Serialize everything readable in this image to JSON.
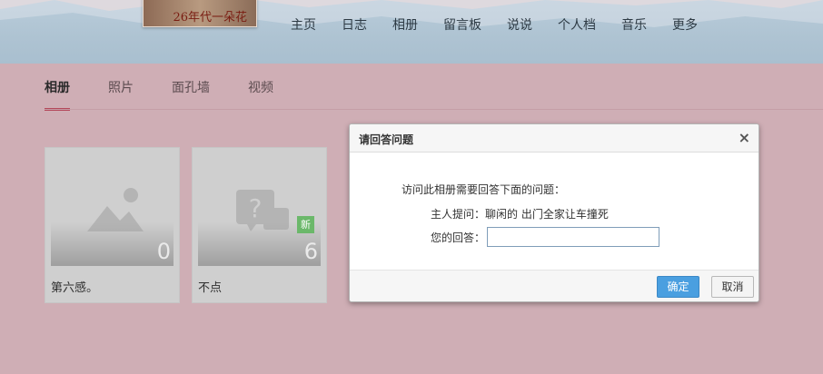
{
  "header": {
    "avatar_caption": "26年代一朵花",
    "nav": [
      "主页",
      "日志",
      "相册",
      "留言板",
      "说说",
      "个人档",
      "音乐",
      "更多"
    ]
  },
  "tabs": [
    "相册",
    "照片",
    "面孔墙",
    "视频"
  ],
  "albums": [
    {
      "title": "第六感。",
      "count": "0",
      "icon": "image-placeholder-icon"
    },
    {
      "title": "不点",
      "count": "6",
      "icon": "question-lock-icon",
      "badge": "新"
    }
  ],
  "dialog": {
    "title": "请回答问题",
    "close_glyph": "×",
    "intro": "访问此相册需要回答下面的问题：",
    "question_label": "主人提问：",
    "question_text": "聊闲的 出门全家让车撞死",
    "answer_label": "您的回答：",
    "answer_value": "",
    "ok_label": "确定",
    "cancel_label": "取消"
  },
  "colors": {
    "page_bg": "#cfaeb5",
    "tab_active_underline": "#b4475a",
    "ok_button": "#4a9fe0",
    "new_badge": "#6bb86a"
  }
}
